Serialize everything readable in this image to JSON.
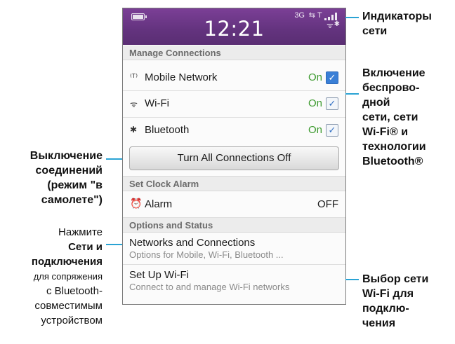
{
  "status_bar": {
    "time": "12:21",
    "network_type": "3G",
    "icons": [
      "battery-icon",
      "data-transfer-icon",
      "signal-strength-icon",
      "wifi-icon",
      "bluetooth-icon"
    ]
  },
  "sections": {
    "manage_connections": "Manage Connections",
    "set_clock_alarm": "Set Clock Alarm",
    "options_and_status": "Options and Status"
  },
  "connections": [
    {
      "label": "Mobile Network",
      "state": "On",
      "icon": "antenna-icon"
    },
    {
      "label": "Wi-Fi",
      "state": "On",
      "icon": "wifi-icon"
    },
    {
      "label": "Bluetooth",
      "state": "On",
      "icon": "bluetooth-icon"
    }
  ],
  "turn_off_button": "Turn All Connections Off",
  "alarm": {
    "label": "Alarm",
    "state": "OFF",
    "icon": "alarm-clock-icon"
  },
  "options": [
    {
      "title": "Networks and Connections",
      "subtitle": "Options for Mobile, Wi-Fi, Bluetooth ..."
    },
    {
      "title": "Set Up Wi-Fi",
      "subtitle": "Connect to and manage Wi-Fi networks"
    }
  ],
  "callouts": {
    "network_indicators": [
      "Индикаторы",
      "сети"
    ],
    "wireless_toggle": [
      "Включение",
      "беспрово-",
      "дной",
      "сети, сети",
      "Wi-Fi® и",
      "технологии",
      "Bluetooth®"
    ],
    "airplane_mode": [
      "Выключение",
      "соединений",
      "(режим \"в",
      "самолете\")"
    ],
    "press_prefix": "Нажмите",
    "press_bold": [
      "Сети и",
      "подключения"
    ],
    "press_suffix": [
      "для сопряжения",
      "с Bluetooth-",
      "совместимым",
      "устройством"
    ],
    "wifi_select": [
      "Выбор сети",
      "Wi-Fi для",
      "подклю-",
      "чения"
    ]
  },
  "colors": {
    "status_bar": "#63337e",
    "accent_line": "#2aa3d4",
    "on_green": "#3c9a2e",
    "checkbox_blue": "#3a7fd6"
  }
}
